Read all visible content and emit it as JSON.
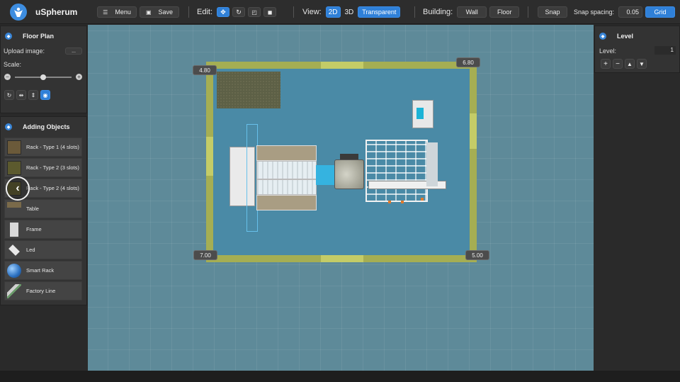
{
  "app": {
    "title": "uSpherum"
  },
  "toolbar": {
    "menu_label": "Menu",
    "save_label": "Save",
    "edit_label": "Edit:",
    "view_label": "View:",
    "view_2d": "2D",
    "view_3d": "3D",
    "transparent_label": "Transparent",
    "building_label": "Building:",
    "wall_label": "Wall",
    "floor_label": "Floor",
    "snap_label": "Snap",
    "snap_spacing_label": "Snap spacing:",
    "snap_spacing_value": "0.05",
    "grid_label": "Grid"
  },
  "floor_plan": {
    "title": "Floor Plan",
    "upload_label": "Upload image:",
    "upload_button": "...",
    "scale_label": "Scale:",
    "scale_minus": "−",
    "scale_plus": "+",
    "scale_value": 0.5
  },
  "adding_objects": {
    "title": "Adding Objects",
    "items": [
      {
        "label": "Rack - Type 1 (4 slots)"
      },
      {
        "label": "Rack - Type 2 (3 slots)"
      },
      {
        "label": "Rack - Type 2 (4 slots)"
      },
      {
        "label": "Table"
      },
      {
        "label": "Frame"
      },
      {
        "label": "Led"
      },
      {
        "label": "Smart Rack"
      },
      {
        "label": "Factory Line"
      }
    ]
  },
  "level": {
    "title": "Level",
    "level_label": "Level:",
    "level_value": "1"
  },
  "dimensions": {
    "top_left": "4.80",
    "top_right": "6.80",
    "bottom_left": "7.00",
    "bottom_right": "5.00"
  },
  "nav": {
    "prev": "‹",
    "next": "›"
  }
}
